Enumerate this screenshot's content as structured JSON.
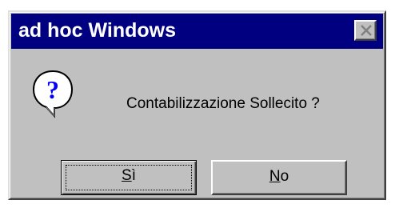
{
  "window": {
    "title": "ad hoc Windows"
  },
  "message": {
    "text": "Contabilizzazione Sollecito ?",
    "icon": "question-icon"
  },
  "buttons": {
    "yes_mnemonic": "S",
    "yes_rest": "ì",
    "no_mnemonic": "N",
    "no_rest": "o"
  },
  "colors": {
    "titlebar": "#000080",
    "face": "#c0c0c0",
    "icon_blue": "#0000ff"
  }
}
